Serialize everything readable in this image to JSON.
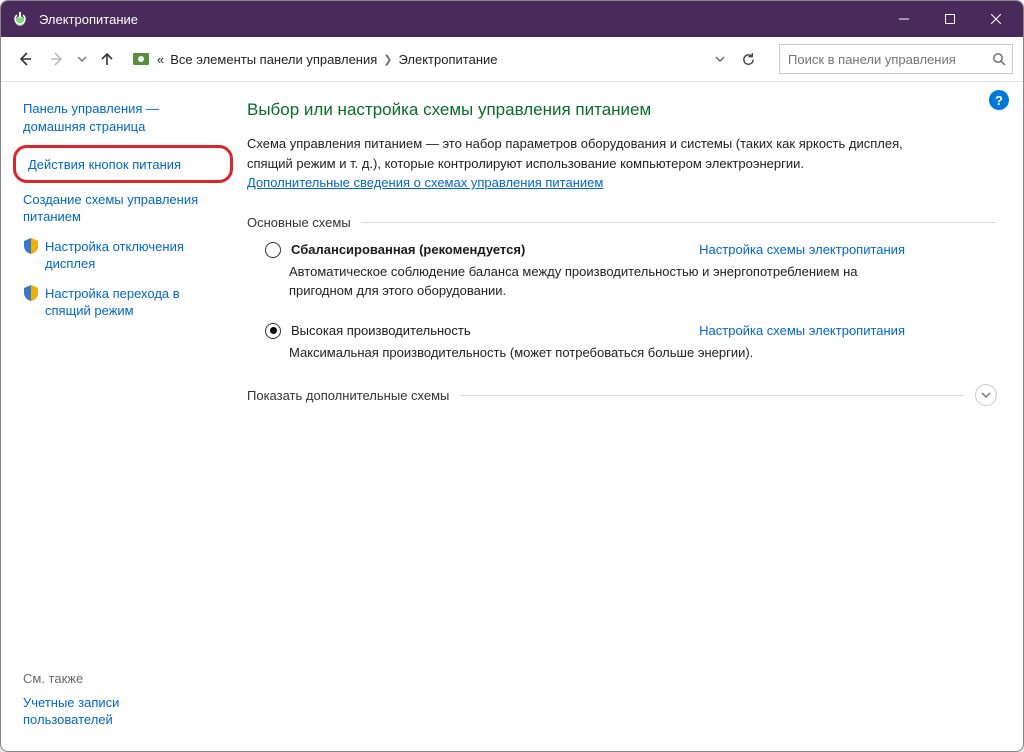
{
  "titlebar": {
    "title": "Электропитание"
  },
  "nav": {
    "levels_prefix": "«",
    "crumb1": "Все элементы панели управления",
    "crumb2": "Электропитание",
    "search_placeholder": "Поиск в панели управления"
  },
  "sidebar": {
    "home1": "Панель управления —",
    "home2": "домашняя страница",
    "button_actions": "Действия кнопок питания",
    "create_plan1": "Создание схемы управления",
    "create_plan2": "питанием",
    "display_off1": "Настройка отключения",
    "display_off2": "дисплея",
    "sleep1": "Настройка перехода в",
    "sleep2": "спящий режим",
    "see_also": "См. также",
    "user_accounts1": "Учетные записи",
    "user_accounts2": "пользователей"
  },
  "main": {
    "heading": "Выбор или настройка схемы управления питанием",
    "lead": "Схема управления питанием — это набор параметров оборудования и системы (таких как яркость дисплея, спящий режим и т. д.), которые контролируют использование компьютером электроэнергии.",
    "lead_link": "Дополнительные сведения о схемах управления питанием",
    "group_basic": "Основные схемы",
    "plan1_name": "Сбалансированная (рекомендуется)",
    "plan1_desc": "Автоматическое соблюдение баланса между производительностью и энергопотреблением на пригодном для этого оборудовании.",
    "plan2_name": "Высокая производительность",
    "plan2_desc": "Максимальная производительность (может потребоваться больше энергии).",
    "plan_settings_link": "Настройка схемы электропитания",
    "show_more": "Показать дополнительные схемы"
  }
}
